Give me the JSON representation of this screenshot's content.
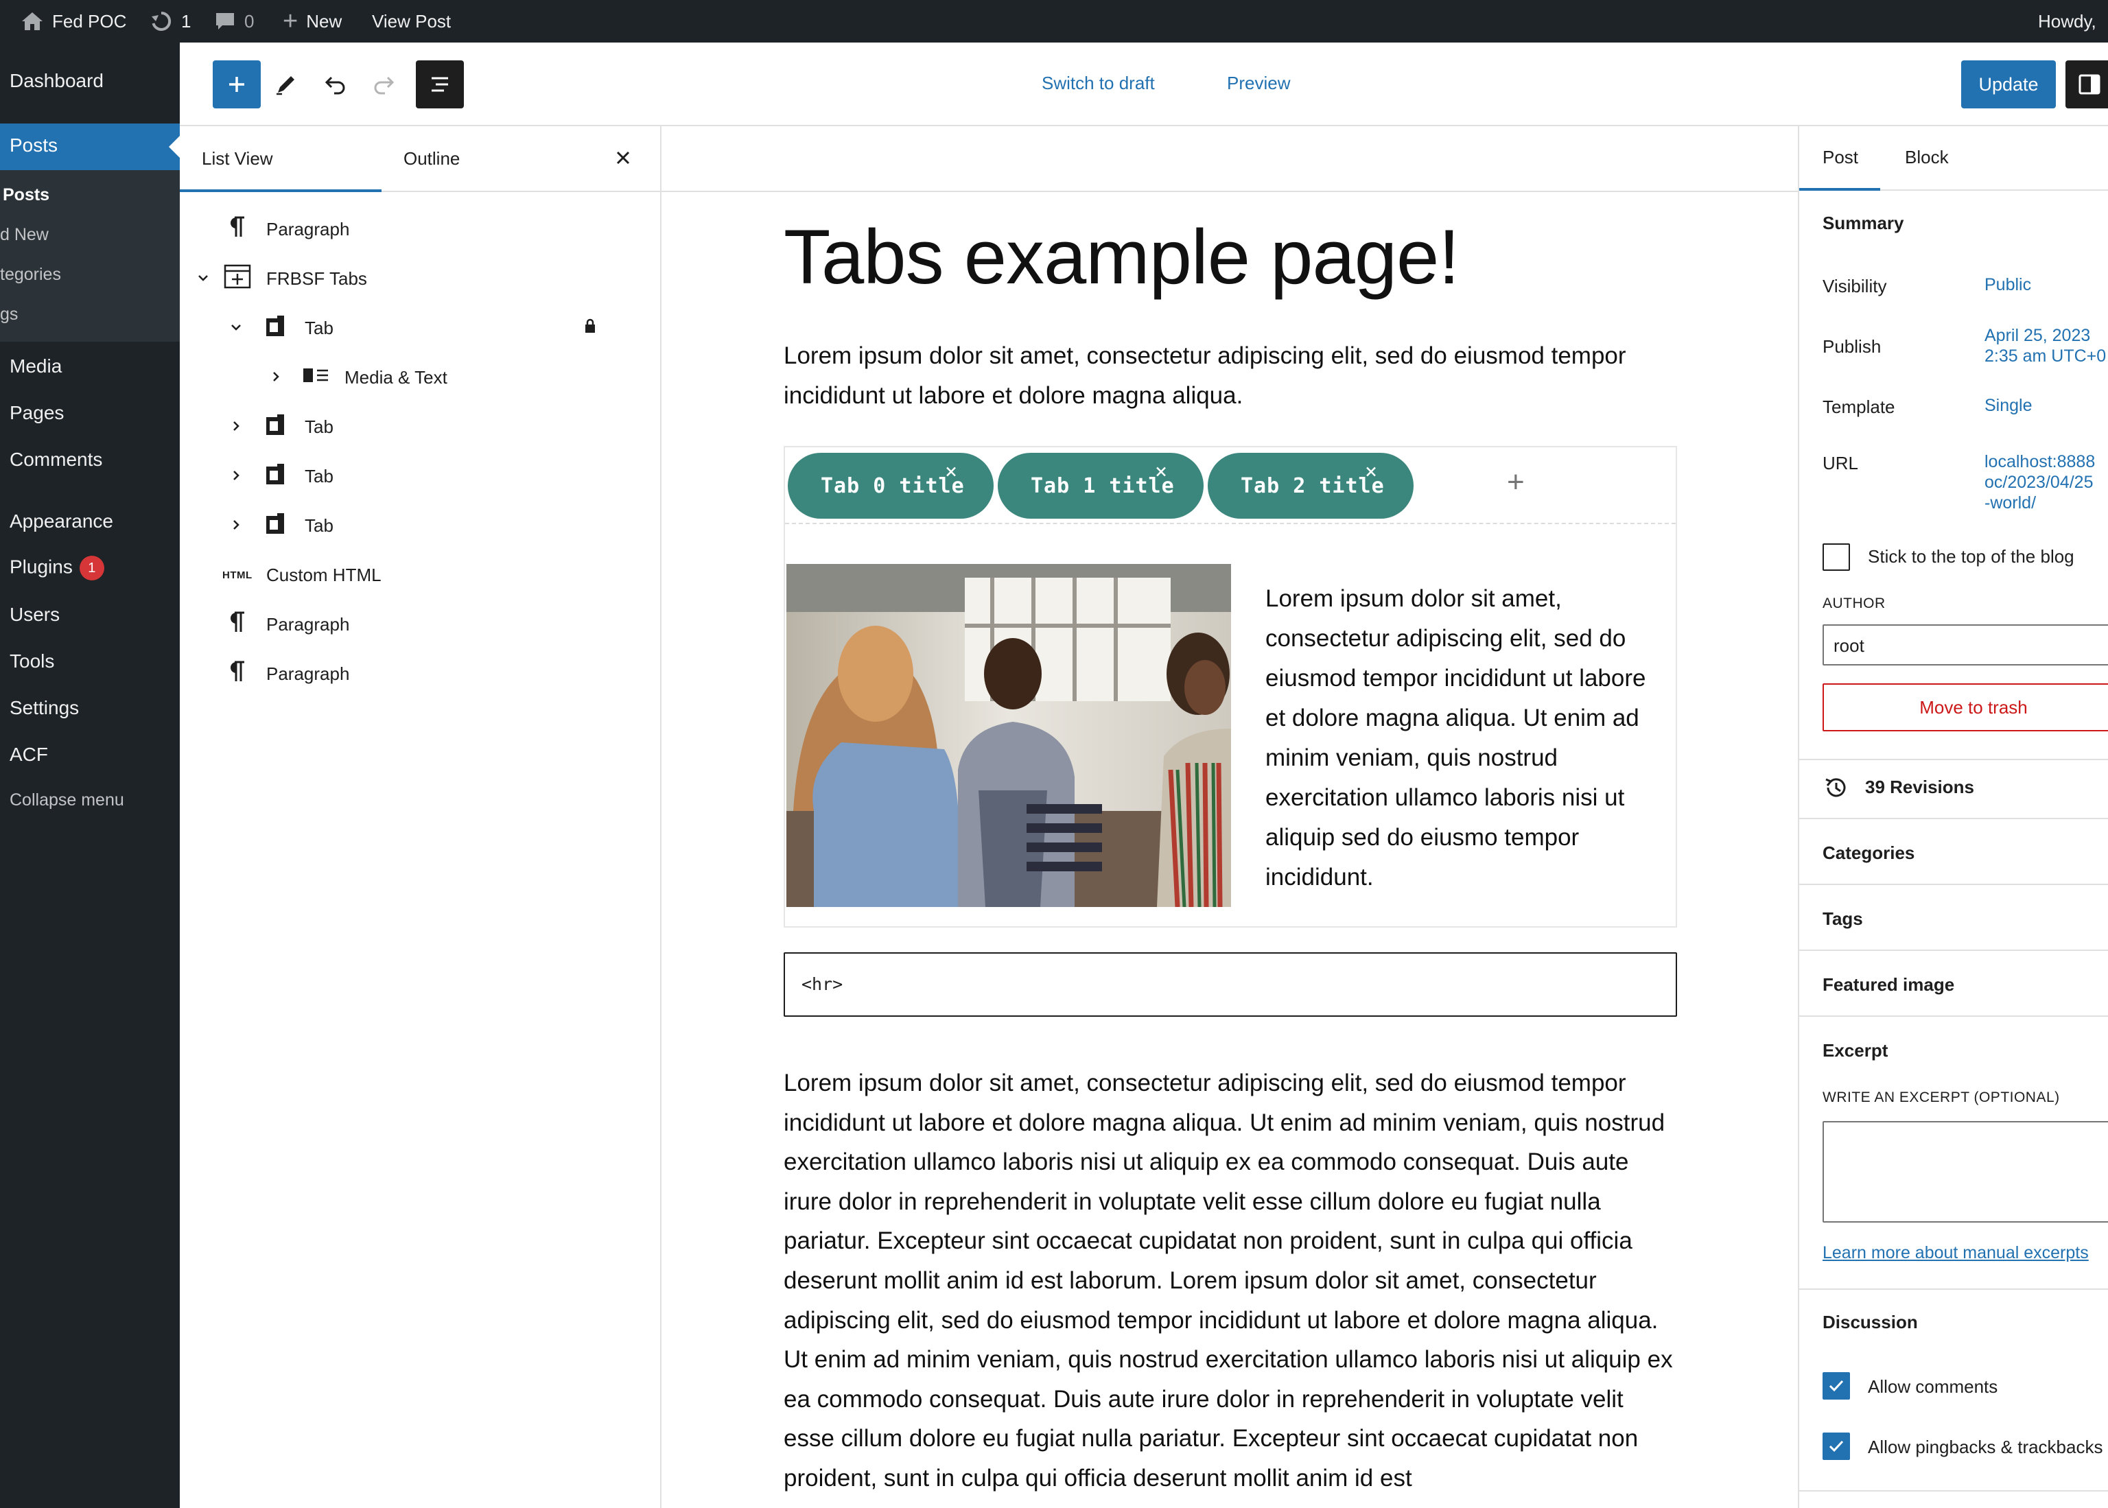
{
  "adminbar": {
    "site_name": "Fed POC",
    "updates_count": "1",
    "comments_count": "0",
    "new_label": "New",
    "view_post_label": "View Post",
    "howdy": "Howdy,"
  },
  "adminmenu": {
    "dashboard": "Dashboard",
    "posts": "Posts",
    "sub_all_posts": "Posts",
    "sub_add_new": "d New",
    "sub_categories": "tegories",
    "sub_tags": "gs",
    "media": "Media",
    "pages": "Pages",
    "comments": "Comments",
    "appearance": "Appearance",
    "plugins": "Plugins",
    "plugins_badge": "1",
    "users": "Users",
    "tools": "Tools",
    "settings": "Settings",
    "acf": "ACF",
    "collapse": "Collapse menu"
  },
  "header": {
    "switch_to_draft": "Switch to draft",
    "preview": "Preview",
    "update": "Update"
  },
  "listview": {
    "tab_list": "List View",
    "tab_outline": "Outline",
    "items": [
      {
        "label": "Paragraph",
        "icon": "paragraph-icon"
      },
      {
        "label": "FRBSF Tabs",
        "icon": "table-icon"
      },
      {
        "label": "Tab",
        "icon": "tab-icon"
      },
      {
        "label": "Media & Text",
        "icon": "media-text-icon"
      },
      {
        "label": "Tab",
        "icon": "tab-icon"
      },
      {
        "label": "Tab",
        "icon": "tab-icon"
      },
      {
        "label": "Tab",
        "icon": "tab-icon"
      },
      {
        "label": "Custom HTML",
        "icon": "html-icon",
        "icon_text": "HTML"
      },
      {
        "label": "Paragraph",
        "icon": "paragraph-icon"
      },
      {
        "label": "Paragraph",
        "icon": "paragraph-icon"
      }
    ]
  },
  "canvas": {
    "title": "Tabs example page!",
    "intro": "Lorem ipsum dolor sit amet, consectetur adipiscing elit, sed do eiusmod tempor incididunt ut labore et dolore magna aliqua.",
    "tabs": [
      "Tab 0 title",
      "Tab 1 title",
      "Tab 2 title"
    ],
    "tab_close": "×",
    "tab_add": "+",
    "media_text": "Lorem ipsum dolor sit amet, consectetur adipiscing elit, sed do eiusmod tempor incididunt ut labore et dolore magna aliqua. Ut enim ad minim veniam, quis nostrud exercitation ullamco laboris nisi ut aliquip sed do eiusmo tempor incididunt.",
    "html_code": "<hr>",
    "body": "Lorem ipsum dolor sit amet, consectetur adipiscing elit, sed do eiusmod tempor incididunt ut labore et dolore magna aliqua. Ut enim ad minim veniam, quis nostrud exercitation ullamco laboris nisi ut aliquip ex ea commodo consequat. Duis aute irure dolor in reprehenderit in voluptate velit esse cillum dolore eu fugiat nulla pariatur. Excepteur sint occaecat cupidatat non proident, sunt in culpa qui officia deserunt mollit anim id est laborum. Lorem ipsum dolor sit amet, consectetur adipiscing elit, sed do eiusmod tempor incididunt ut labore et dolore magna aliqua. Ut enim ad minim veniam, quis nostrud exercitation ullamco laboris nisi ut aliquip ex ea commodo consequat. Duis aute irure dolor in reprehenderit in voluptate velit esse cillum dolore eu fugiat nulla pariatur. Excepteur sint occaecat cupidatat non proident, sunt in culpa qui officia deserunt mollit anim id est"
  },
  "sidebar": {
    "tab_post": "Post",
    "tab_block": "Block",
    "summary": "Summary",
    "visibility_label": "Visibility",
    "visibility_value": "Public",
    "publish_label": "Publish",
    "publish_value_1": "April 25, 2023",
    "publish_value_2": "2:35 am UTC+0",
    "template_label": "Template",
    "template_value": "Single",
    "url_label": "URL",
    "url_value_1": "localhost:8888",
    "url_value_2": "oc/2023/04/25",
    "url_value_3": "-world/",
    "sticky_label": "Stick to the top of the blog",
    "author_caps": "AUTHOR",
    "author_value": "root",
    "trash": "Move to trash",
    "revisions": "39 Revisions",
    "categories": "Categories",
    "tags": "Tags",
    "featured_image": "Featured image",
    "excerpt": "Excerpt",
    "excerpt_caps": "WRITE AN EXCERPT (OPTIONAL)",
    "learn_more": "Learn more about manual excerpts",
    "discussion": "Discussion",
    "allow_comments": "Allow comments",
    "allow_pingbacks": "Allow pingbacks & trackbacks"
  },
  "colors": {
    "wp_blue": "#2271b1",
    "admin_dark": "#1d2327",
    "tab_teal": "#3b877e",
    "danger": "#cc1818",
    "badge_red": "#d63638"
  }
}
